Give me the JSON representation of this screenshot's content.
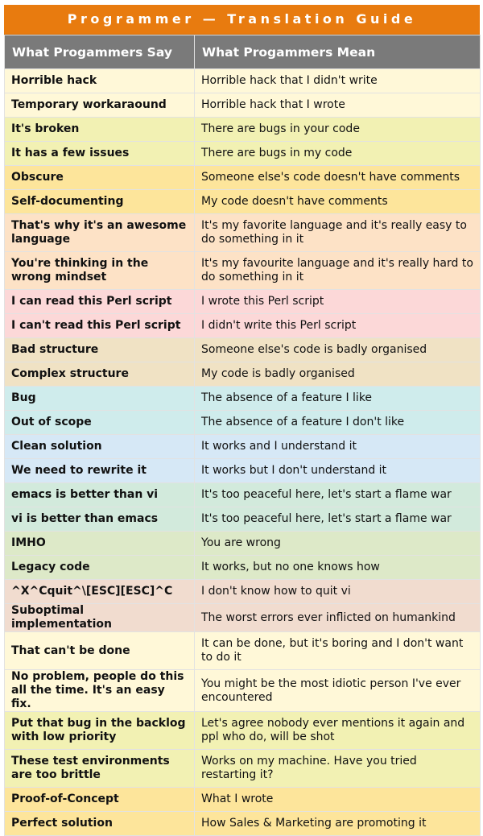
{
  "title": "Programmer — Translation Guide",
  "headers": {
    "say": "What Progammers Say",
    "mean": "What Progammers Mean"
  },
  "rows": [
    {
      "say": "Horrible hack",
      "mean": "Horrible hack that I didn't write",
      "color": "#fff8d8",
      "lines": 1
    },
    {
      "say": "Temporary workaraound",
      "mean": "Horrible hack that I wrote",
      "color": "#fff8d8",
      "lines": 1
    },
    {
      "say": "It's broken",
      "mean": "There are bugs in your code",
      "color": "#f2f1b3",
      "lines": 1
    },
    {
      "say": "It has a few issues",
      "mean": "There are bugs in my code",
      "color": "#f2f1b3",
      "lines": 1
    },
    {
      "say": "Obscure",
      "mean": "Someone else's code doesn't have comments",
      "color": "#fde59b",
      "lines": 1
    },
    {
      "say": "Self-documenting",
      "mean": "My code doesn't have comments",
      "color": "#fde59b",
      "lines": 1
    },
    {
      "say": "That's why it's an awesome language",
      "mean": "It's my favorite language and it's really easy to do something in it",
      "color": "#fde2c6",
      "lines": 2
    },
    {
      "say": "You're thinking in the wrong mindset",
      "mean": "It's my favourite language and it's really hard to do something in it",
      "color": "#fde2c6",
      "lines": 2
    },
    {
      "say": "I can read this Perl script",
      "mean": "I wrote this Perl script",
      "color": "#fcd8d8",
      "lines": 1
    },
    {
      "say": "I can't read this Perl script",
      "mean": "I didn't write this Perl script",
      "color": "#fcd8d8",
      "lines": 1
    },
    {
      "say": "Bad structure",
      "mean": "Someone else's code is badly organised",
      "color": "#f0e2c4",
      "lines": 1
    },
    {
      "say": "Complex structure",
      "mean": "My code is badly organised",
      "color": "#f0e2c4",
      "lines": 1
    },
    {
      "say": "Bug",
      "mean": "The absence of a feature I like",
      "color": "#cfecec",
      "lines": 1
    },
    {
      "say": "Out of scope",
      "mean": "The absence of a feature I don't like",
      "color": "#cfecec",
      "lines": 1
    },
    {
      "say": "Clean solution",
      "mean": "It works and I understand it",
      "color": "#d6e8f6",
      "lines": 1
    },
    {
      "say": "We need to rewrite it",
      "mean": "It works but I don't understand it",
      "color": "#d6e8f6",
      "lines": 1
    },
    {
      "say": "emacs is better than vi",
      "mean": "It's too peaceful here, let's start a flame war",
      "color": "#d2eadc",
      "lines": 1
    },
    {
      "say": "vi is better than emacs",
      "mean": "It's too peaceful here, let's start a flame war",
      "color": "#d2eadc",
      "lines": 1
    },
    {
      "say": "IMHO",
      "mean": "You are wrong",
      "color": "#dde9c8",
      "lines": 1
    },
    {
      "say": "Legacy code",
      "mean": "It works, but no one knows how",
      "color": "#dde9c8",
      "lines": 1
    },
    {
      "say": "^X^Cquit^\\[ESC][ESC]^C",
      "mean": "I don't know how to quit vi",
      "color": "#f1dccf",
      "lines": 1
    },
    {
      "say": "Suboptimal implementation",
      "mean": "The worst errors ever inflicted on humankind",
      "color": "#f1dccf",
      "lines": 1
    },
    {
      "say": "That can't be done",
      "mean": "It can be done, but it's boring and I don't want to do it",
      "color": "#fff8d8",
      "lines": 2
    },
    {
      "say": "No problem, people do this all the time. It's an easy fix.",
      "mean": "You might be the most idiotic person I've ever encountered",
      "color": "#fff8d8",
      "lines": 2
    },
    {
      "say": "Put that bug in the backlog with low priority",
      "mean": "Let's agree nobody ever mentions it again and ppl who do, will be shot",
      "color": "#f2f1b3",
      "lines": 2
    },
    {
      "say": "These test environments are too brittle",
      "mean": "Works on my machine. Have you tried restarting it?",
      "color": "#f2f1b3",
      "lines": 2
    },
    {
      "say": "Proof-of-Concept",
      "mean": "What I wrote",
      "color": "#fde59b",
      "lines": 1
    },
    {
      "say": "Perfect solution",
      "mean": "How Sales & Marketing are promoting it",
      "color": "#fde59b",
      "lines": 1
    }
  ]
}
